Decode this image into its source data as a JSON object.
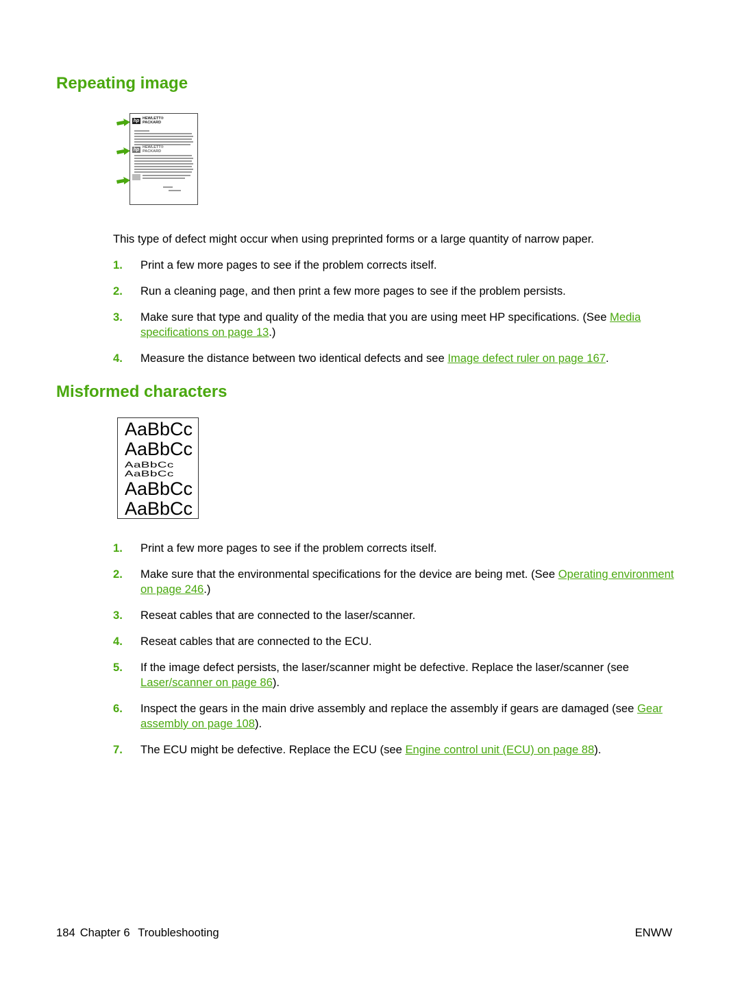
{
  "colors": {
    "accent": "#4aa80f",
    "text": "#000000"
  },
  "sections": [
    {
      "heading": "Repeating image",
      "figure": {
        "type": "repeating-image-sample",
        "logo_text_line1": "HEWLETT®",
        "logo_text_line2": "PACKARD",
        "logo_mark": "hp",
        "arrows": 3
      },
      "intro": "This type of defect might occur when using preprinted forms or a large quantity of narrow paper.",
      "steps": [
        {
          "num": "1.",
          "text": "Print a few more pages to see if the problem corrects itself.",
          "link": "",
          "after": ""
        },
        {
          "num": "2.",
          "text": "Run a cleaning page, and then print a few more pages to see if the problem persists.",
          "link": "",
          "after": ""
        },
        {
          "num": "3.",
          "text": "Make sure that type and quality of the media that you are using meet HP specifications. (See ",
          "link": "Media specifications on page 13",
          "after": ".)"
        },
        {
          "num": "4.",
          "text": "Measure the distance between two identical defects and see ",
          "link": "Image defect ruler on page 167",
          "after": "."
        }
      ]
    },
    {
      "heading": "Misformed characters",
      "figure": {
        "type": "misformed-characters-sample",
        "samples": [
          "AaBbCc",
          "AaBbCc",
          "AaBbCc",
          "AaBbCc",
          "AaBbCc",
          "AaBbCc"
        ]
      },
      "steps": [
        {
          "num": "1.",
          "text": "Print a few more pages to see if the problem corrects itself.",
          "link": "",
          "after": ""
        },
        {
          "num": "2.",
          "text": "Make sure that the environmental specifications for the device are being met. (See ",
          "link": "Operating environment on page 246",
          "after": ".)"
        },
        {
          "num": "3.",
          "text": "Reseat cables that are connected to the laser/scanner.",
          "link": "",
          "after": ""
        },
        {
          "num": "4.",
          "text": "Reseat cables that are connected to the ECU.",
          "link": "",
          "after": ""
        },
        {
          "num": "5.",
          "text": "If the image defect persists, the laser/scanner might be defective. Replace the laser/scanner (see ",
          "link": "Laser/scanner on page 86",
          "after": ")."
        },
        {
          "num": "6.",
          "text": "Inspect the gears in the main drive assembly and replace the assembly if gears are damaged (see ",
          "link": "Gear assembly on page 108",
          "after": ")."
        },
        {
          "num": "7.",
          "text": "The ECU might be defective. Replace the ECU (see ",
          "link": "Engine control unit (ECU) on page 88",
          "after": ")."
        }
      ]
    }
  ],
  "footer": {
    "page_number": "184",
    "chapter": "Chapter 6",
    "chapter_title": "Troubleshooting",
    "doc_code": "ENWW"
  }
}
